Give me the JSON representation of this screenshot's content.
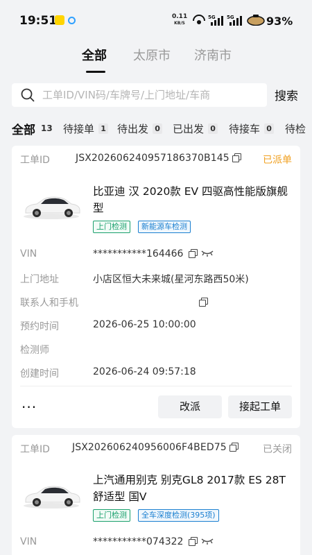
{
  "status_bar": {
    "time": "19:51",
    "net_speed": "0.11",
    "net_speed_unit": "KB/S",
    "signal_1": "5G",
    "signal_2": "5G",
    "battery": "93%"
  },
  "city_tabs": [
    {
      "label": "全部",
      "active": true
    },
    {
      "label": "太原市",
      "active": false
    },
    {
      "label": "济南市",
      "active": false
    }
  ],
  "search": {
    "placeholder": "工单ID/VIN码/车牌号/上门地址/车商",
    "value": "",
    "button_label": "搜索"
  },
  "filter_tabs": [
    {
      "label": "全部",
      "count": "13",
      "active": true
    },
    {
      "label": "待接单",
      "count": "1"
    },
    {
      "label": "待出发",
      "count": "0"
    },
    {
      "label": "已出发",
      "count": "0"
    },
    {
      "label": "待接车",
      "count": "0"
    },
    {
      "label": "待检",
      "count": ""
    }
  ],
  "labels": {
    "order_id": "工单ID",
    "vin": "VIN",
    "address": "上门地址",
    "contact": "联系人和手机",
    "appointment": "预约时间",
    "inspector": "检测师",
    "created": "创建时间"
  },
  "orders": [
    {
      "id": "JSX202606240957186370B145",
      "status": "已派单",
      "status_color": "#f0a020",
      "car_title": "比亚迪 汉 2020款 EV 四驱高性能版旗舰型",
      "tags": [
        "上门检测",
        "新能源车检测"
      ],
      "vin": "***********164466",
      "address": "小店区恒大未来城(星河东路西50米)",
      "contact": "",
      "appointment": "2026-06-25 10:00:00",
      "inspector": "",
      "created": "2026-06-24 09:57:18",
      "more_label": "···",
      "actions": [
        "改派",
        "接起工单"
      ]
    },
    {
      "id": "JSX202606240956006F4BED75",
      "status": "已关闭",
      "status_color": "#999999",
      "car_title": "上汽通用别克 别克GL8 2017款 ES 28T 舒适型 国V",
      "tags": [
        "上门检测",
        "全车深度检测(395项)"
      ],
      "vin": "***********074322"
    }
  ]
}
